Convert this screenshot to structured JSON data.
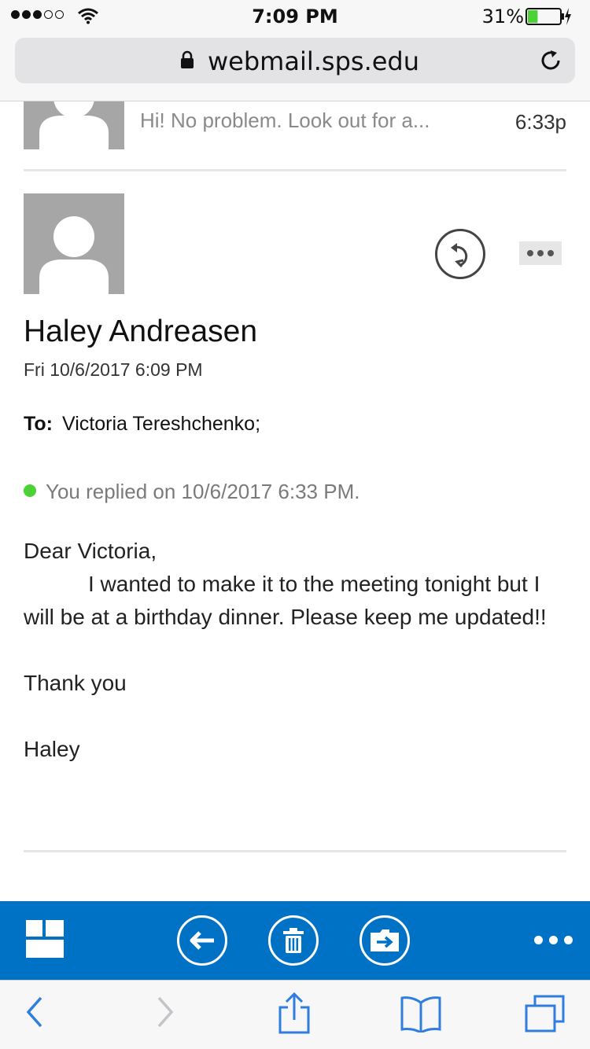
{
  "status_bar": {
    "time": "7:09 PM",
    "battery_percent": "31%",
    "battery_level": 0.31,
    "signal_bars_filled": 3,
    "signal_bars_total": 5,
    "icons": [
      "signal-dots-icon",
      "wifi-icon",
      "battery-icon",
      "charging-bolt-icon"
    ]
  },
  "browser": {
    "url": "webmail.sps.edu",
    "icons": [
      "lock-icon",
      "reload-icon"
    ]
  },
  "previous_message": {
    "snippet": "Hi! No problem. Look out for a...",
    "time": "6:33p"
  },
  "message": {
    "sender": "Haley Andreasen",
    "date": "Fri 10/6/2017 6:09 PM",
    "to_label": "To:",
    "to_value": "Victoria Tereshchenko;",
    "replied_notice": "You replied on 10/6/2017 6:33 PM.",
    "body": {
      "greeting": "Dear Victoria,",
      "paragraph": "I wanted to make it to the meeting tonight but I will be at a birthday dinner. Please keep me updated!!",
      "closing": "Thank you",
      "signature": "Haley"
    }
  },
  "owa_toolbar": {
    "buttons": [
      "tiles-icon",
      "back-arrow-icon",
      "trash-icon",
      "move-to-folder-icon",
      "more-icon"
    ],
    "color": "#0072c6"
  },
  "safari_toolbar": {
    "buttons": [
      "back-chevron-icon",
      "forward-chevron-icon",
      "share-icon",
      "bookmarks-icon",
      "tabs-icon"
    ],
    "accent": "#2f7de1"
  }
}
